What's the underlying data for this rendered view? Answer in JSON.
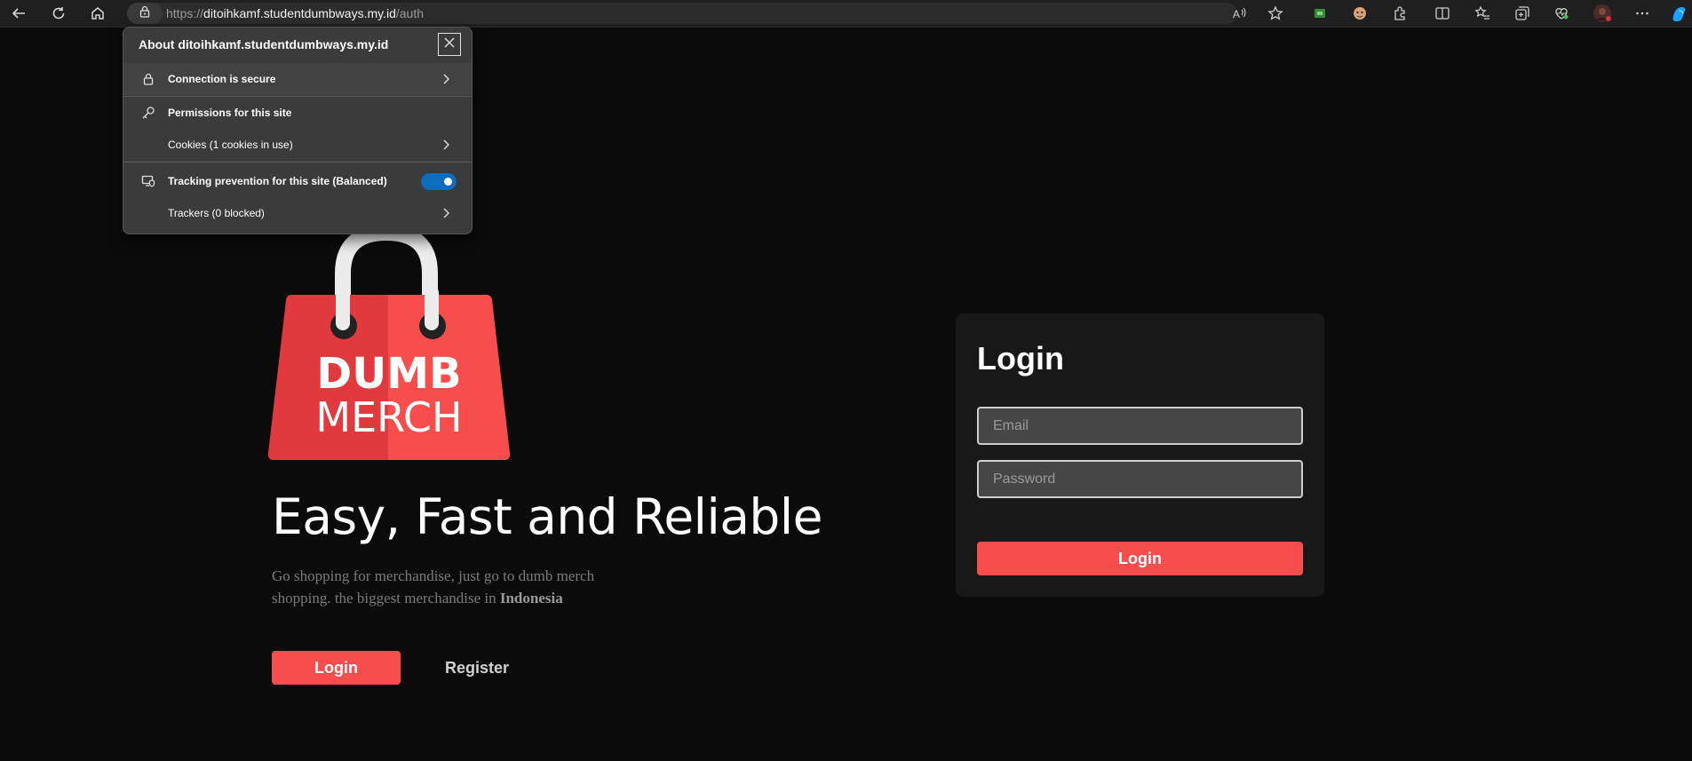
{
  "browser": {
    "url_scheme": "https://",
    "url_host": "ditoihkamf.studentdumbways.my.id",
    "url_path": "/auth",
    "icons": [
      "back-icon",
      "refresh-icon",
      "home-icon",
      "lock-icon",
      "read-aloud-icon",
      "favorite-star-icon",
      "extension-icon",
      "extension-icon",
      "extensions-puzzle-icon",
      "split-screen-icon",
      "favorites-icon",
      "collections-icon",
      "browser-essentials-icon",
      "profile-avatar",
      "more-icon",
      "copilot-icon"
    ]
  },
  "site_info": {
    "title": "About ditoihkamf.studentdumbways.my.id",
    "connection": "Connection is secure",
    "permissions": "Permissions for this site",
    "cookies": "Cookies (1 cookies in use)",
    "tracking": "Tracking prevention for this site (Balanced)",
    "tracking_enabled": true,
    "trackers": "Trackers (0 blocked)"
  },
  "logo": {
    "line1": "DUMB",
    "line2": "MERCH",
    "color_left": "#e03a3e",
    "color_right": "#f74d4d"
  },
  "hero": {
    "title": "Easy, Fast and Reliable",
    "desc_text": "Go shopping for merchandise, just go to dumb merch shopping. the biggest merchandise in",
    "desc_bold": "Indonesia",
    "login_label": "Login",
    "register_label": "Register"
  },
  "login_card": {
    "title": "Login",
    "email_placeholder": "Email",
    "password_placeholder": "Password",
    "submit_label": "Login"
  },
  "colors": {
    "accent": "#f74d4d",
    "background": "#0b0b0b",
    "card": "#181818",
    "toggle": "#0f6cbd"
  }
}
